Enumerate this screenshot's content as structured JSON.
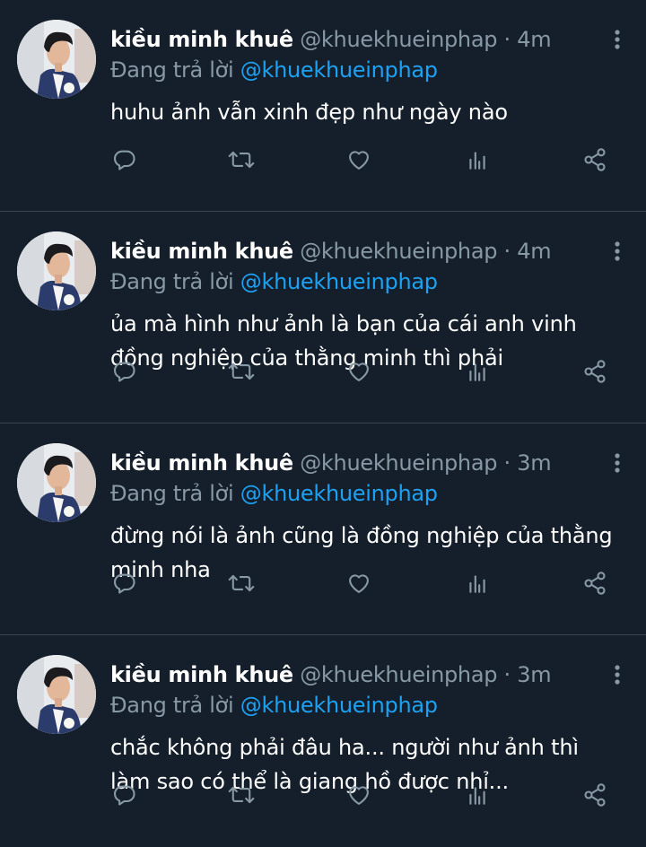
{
  "colors": {
    "background": "#151f2b",
    "secondary_text": "#8899a6",
    "mention": "#1da1f2",
    "divider": "#38444d"
  },
  "icons": {
    "reply": "reply-icon",
    "retweet": "retweet-icon",
    "like": "heart-icon",
    "stats": "analytics-icon",
    "share": "share-icon",
    "more": "more-vertical-icon"
  },
  "tweets": [
    {
      "name": "kiều minh khuê",
      "handle": "@khuekhueinphap",
      "separator": "·",
      "time": "4m",
      "reply_prefix": "Đang trả lời",
      "reply_to": "@khuekhueinphap",
      "text": "huhu ảnh vẫn xinh đẹp như ngày nào"
    },
    {
      "name": "kiều minh khuê",
      "handle": "@khuekhueinphap",
      "separator": "·",
      "time": "4m",
      "reply_prefix": "Đang trả lời",
      "reply_to": "@khuekhueinphap",
      "text": "ủa mà hình như ảnh là bạn của cái anh vinh đồng nghiệp của thằng minh thì phải"
    },
    {
      "name": "kiều minh khuê",
      "handle": "@khuekhueinphap",
      "separator": "·",
      "time": "3m",
      "reply_prefix": "Đang trả lời",
      "reply_to": "@khuekhueinphap",
      "text": "đừng nói là ảnh cũng là đồng nghiệp của thằng minh nha"
    },
    {
      "name": "kiều minh khuê",
      "handle": "@khuekhueinphap",
      "separator": "·",
      "time": "3m",
      "reply_prefix": "Đang trả lời",
      "reply_to": "@khuekhueinphap",
      "text": "chắc không phải đâu ha... người như ảnh thì làm sao có thể là giang hồ được nhỉ..."
    }
  ]
}
